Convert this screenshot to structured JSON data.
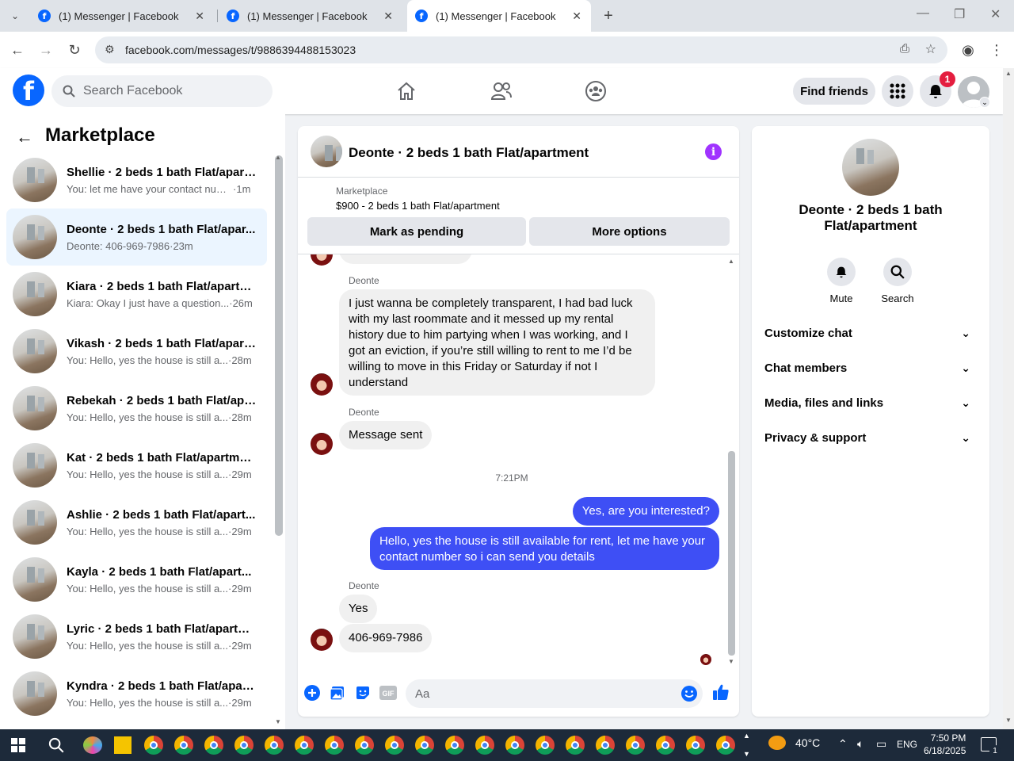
{
  "browser": {
    "tabs": [
      {
        "title": "(1) Messenger | Facebook"
      },
      {
        "title": "(1) Messenger | Facebook"
      },
      {
        "title": "(1) Messenger | Facebook"
      }
    ],
    "url": "facebook.com/messages/t/9886394488153023"
  },
  "header": {
    "search_placeholder": "Search Facebook",
    "find_friends": "Find friends",
    "notification_count": "1",
    "logo": "f"
  },
  "sidebar": {
    "title": "Marketplace",
    "conversations": [
      {
        "name": "Shellie · 2 beds 1 bath Flat/apart...",
        "preview": "You: let me have your contact num...",
        "time": "1m"
      },
      {
        "name": "Deonte · 2 beds 1 bath Flat/apar...",
        "preview": "Deonte: 406-969-7986",
        "time": "23m"
      },
      {
        "name": "Kiara · 2 beds 1 bath Flat/apartm...",
        "preview": "Kiara: Okay I just have a question...",
        "time": "26m"
      },
      {
        "name": "Vikash · 2 beds 1 bath Flat/apart...",
        "preview": "You: Hello, yes the house is still a...",
        "time": "28m"
      },
      {
        "name": "Rebekah · 2 beds 1 bath Flat/apa...",
        "preview": "You: Hello, yes the house is still a...",
        "time": "28m"
      },
      {
        "name": "Kat · 2 beds 1 bath Flat/apartment",
        "preview": "You: Hello, yes the house is still a...",
        "time": "29m"
      },
      {
        "name": "Ashlie · 2 beds 1 bath Flat/apart...",
        "preview": "You: Hello, yes the house is still a...",
        "time": "29m"
      },
      {
        "name": "Kayla · 2 beds 1 bath Flat/apart...",
        "preview": "You: Hello, yes the house is still a...",
        "time": "29m"
      },
      {
        "name": "Lyric · 2 beds 1 bath Flat/apartm...",
        "preview": "You: Hello, yes the house is still a...",
        "time": "29m"
      },
      {
        "name": "Kyndra · 2 beds 1 bath Flat/apart...",
        "preview": "You: Hello, yes the house is still a...",
        "time": "29m"
      }
    ]
  },
  "chat": {
    "title": "Deonte · 2 beds 1 bath Flat/apartment",
    "marketplace_label": "Marketplace",
    "listing": "$900 - 2 beds 1 bath Flat/apartment",
    "mark_pending": "Mark as pending",
    "more_options": "More options",
    "messages": {
      "sender": "Deonte",
      "m1": "I just wanna be completely transparent, I had bad luck with my last roommate and it messed up my rental history due to him partying when I was working, and I got an eviction, if you’re still willing to rent to me I’d be willing to move in this Friday or Saturday if not I understand",
      "m2": "Message sent",
      "timestamp": "7:21PM",
      "out1": "Yes, are you interested?",
      "out2": "Hello, yes the house is still available for rent, let me have your contact number so i can send you details",
      "m3": "Yes",
      "m4": "406-969-7986"
    },
    "input_placeholder": "Aa"
  },
  "details": {
    "title": "Deonte · 2 beds 1 bath Flat/apartment",
    "mute": "Mute",
    "search": "Search",
    "sections": [
      "Customize chat",
      "Chat members",
      "Media, files and links",
      "Privacy & support"
    ]
  },
  "taskbar": {
    "temperature": "40°C",
    "language": "ENG",
    "time": "7:50 PM",
    "date": "6/18/2025",
    "notif_count": "1"
  },
  "colors": {
    "accent": "#0866ff",
    "outgoing_bubble": "#3e4ff5",
    "info_purple": "#a033ff",
    "badge_red": "#e41e3f"
  }
}
